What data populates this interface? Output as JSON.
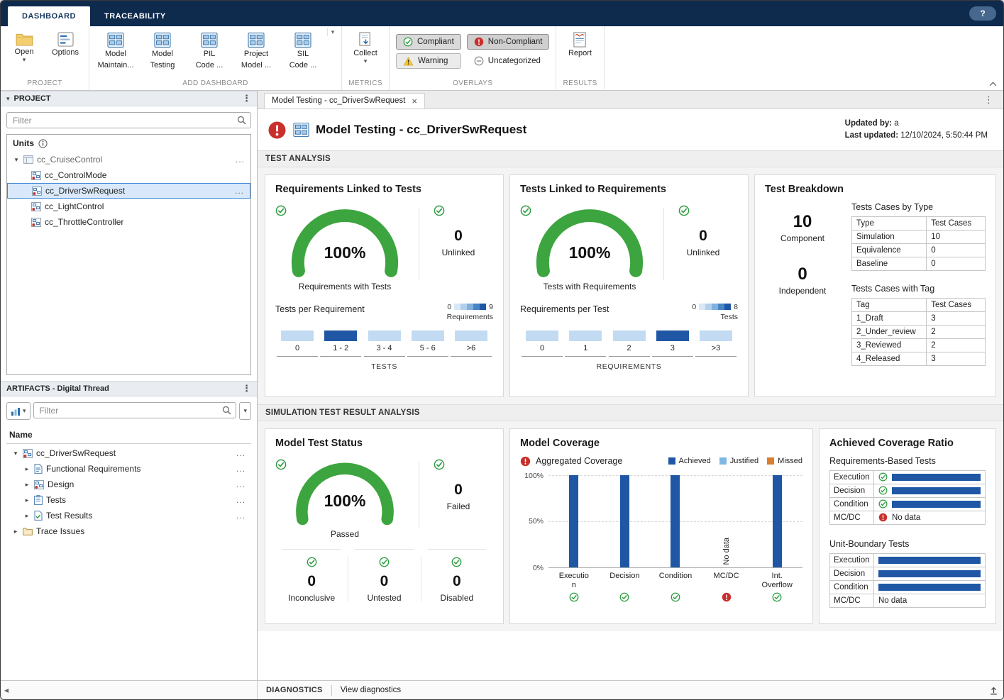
{
  "colors": {
    "navy": "#0e2a4d",
    "green": "#2f9e44",
    "gauge_green": "#3da53f",
    "red": "#c9302c",
    "bar_dark": "#1f57a5",
    "bar_light": "#c2dbf2",
    "justified_blue": "#7fb9e3",
    "missed_orange": "#d97f2e",
    "warning_yellow": "#f3c73f",
    "selection_blue": "#3c87d4"
  },
  "icons": {
    "caret_down": "▾",
    "caret_right": "▸",
    "kebab": "⋮",
    "scroll_left": "◀",
    "close": "×"
  },
  "titlebar": {
    "tabs": [
      {
        "label": "DASHBOARD"
      },
      {
        "label": "TRACEABILITY"
      }
    ],
    "help_label": "?"
  },
  "ribbon": {
    "group_project": "PROJECT",
    "open_label": "Open",
    "options_label": "Options",
    "group_add": "ADD DASHBOARD",
    "dashboards": [
      {
        "line1": "Model",
        "line2": "Maintain..."
      },
      {
        "line1": "Model",
        "line2": "Testing"
      },
      {
        "line1": "PIL",
        "line2": "Code ..."
      },
      {
        "line1": "Project",
        "line2": "Model ..."
      },
      {
        "line1": "SIL",
        "line2": "Code ..."
      }
    ],
    "group_metrics": "METRICS",
    "collect_label": "Collect",
    "group_overlays": "OVERLAYS",
    "overlays": [
      {
        "label": "Compliant"
      },
      {
        "label": "Non-Compliant"
      },
      {
        "label": "Warning"
      },
      {
        "label": "Uncategorized"
      }
    ],
    "group_results": "RESULTS",
    "report_label": "Report"
  },
  "sidebar": {
    "project": {
      "title": "PROJECT",
      "filter_placeholder": "Filter",
      "units_label": "Units",
      "row_menu": "...",
      "tree": [
        {
          "label": "cc_CruiseControl"
        },
        {
          "label": "cc_ControlMode"
        },
        {
          "label": "cc_DriverSwRequest"
        },
        {
          "label": "cc_LightControl"
        },
        {
          "label": "cc_ThrottleController"
        }
      ]
    },
    "artifacts": {
      "title": "ARTIFACTS - Digital Thread",
      "filter_placeholder": "Filter",
      "name_header": "Name",
      "row_menu": "...",
      "tree": [
        {
          "label": "cc_DriverSwRequest"
        },
        {
          "label": "Functional Requirements"
        },
        {
          "label": "Design"
        },
        {
          "label": "Tests"
        },
        {
          "label": "Test Results"
        },
        {
          "label": "Trace Issues"
        }
      ]
    }
  },
  "document": {
    "tab_label": "Model Testing - cc_DriverSwRequest",
    "title": "Model Testing - cc_DriverSwRequest",
    "updated_by_label": "Updated by:",
    "updated_by_value": "a",
    "last_updated_label": "Last updated:",
    "last_updated_value": "12/10/2024, 5:50:44 PM"
  },
  "test_analysis": {
    "section_title": "TEST ANALYSIS",
    "req_linked": {
      "title": "Requirements Linked to Tests",
      "gauge_value": "100%",
      "gauge_label": "Requirements with Tests",
      "unlinked_value": "0",
      "unlinked_label": "Unlinked",
      "hist": {
        "title": "Tests per Requirement",
        "axis_label": "TESTS",
        "scale_min": "0",
        "scale_max": "9",
        "scale_label": "Requirements",
        "bins": [
          {
            "label": "0",
            "count": 0
          },
          {
            "label": "1 - 2",
            "count": 9
          },
          {
            "label": "3 - 4",
            "count": 0
          },
          {
            "label": "5 - 6",
            "count": 0
          },
          {
            "label": ">6",
            "count": 0
          }
        ]
      }
    },
    "tests_linked": {
      "title": "Tests Linked to Requirements",
      "gauge_value": "100%",
      "gauge_label": "Tests with Requirements",
      "unlinked_value": "0",
      "unlinked_label": "Unlinked",
      "hist": {
        "title": "Requirements per Test",
        "axis_label": "REQUIREMENTS",
        "scale_min": "0",
        "scale_max": "8",
        "scale_label": "Tests",
        "bins": [
          {
            "label": "0",
            "count": 0
          },
          {
            "label": "1",
            "count": 0
          },
          {
            "label": "2",
            "count": 0
          },
          {
            "label": "3",
            "count": 8
          },
          {
            "label": ">3",
            "count": 0
          }
        ]
      }
    },
    "breakdown": {
      "title": "Test Breakdown",
      "component_value": "10",
      "component_label": "Component",
      "independent_value": "0",
      "independent_label": "Independent",
      "by_type": {
        "title": "Tests Cases by Type",
        "headers": [
          "Type",
          "Test Cases"
        ],
        "rows": [
          [
            "Simulation",
            "10"
          ],
          [
            "Equivalence",
            "0"
          ],
          [
            "Baseline",
            "0"
          ]
        ]
      },
      "with_tag": {
        "title": "Tests Cases with Tag",
        "headers": [
          "Tag",
          "Test Cases"
        ],
        "rows": [
          [
            "1_Draft",
            "3"
          ],
          [
            "2_Under_review",
            "2"
          ],
          [
            "3_Reviewed",
            "2"
          ],
          [
            "4_Released",
            "3"
          ]
        ]
      }
    }
  },
  "sim_analysis": {
    "section_title": "SIMULATION TEST RESULT ANALYSIS",
    "test_status": {
      "title": "Model Test Status",
      "gauge_value": "100%",
      "gauge_label": "Passed",
      "failed_value": "0",
      "failed_label": "Failed",
      "stats": [
        {
          "value": "0",
          "label": "Inconclusive"
        },
        {
          "value": "0",
          "label": "Untested"
        },
        {
          "value": "0",
          "label": "Disabled"
        }
      ]
    },
    "coverage": {
      "title": "Model Coverage",
      "aggregated_label": "Aggregated Coverage",
      "legend": [
        {
          "label": "Achieved"
        },
        {
          "label": "Justified"
        },
        {
          "label": "Missed"
        }
      ],
      "chart_data": {
        "type": "bar",
        "series_name": "Achieved",
        "categories": [
          "Execution",
          "Decision",
          "Condition",
          "MC/DC",
          "Int. Overflow"
        ],
        "tick_labels": [
          "Executio\nn",
          "Decision",
          "Condition",
          "MC/DC",
          "Int.\nOverflow"
        ],
        "values": [
          100,
          100,
          100,
          null,
          100
        ],
        "statuses": [
          "pass",
          "pass",
          "pass",
          "fail",
          "pass"
        ],
        "no_data_label": "No data",
        "y_ticks": [
          "100%",
          "50%",
          "0%"
        ],
        "ylim": [
          0,
          100
        ]
      }
    },
    "ratio": {
      "title": "Achieved Coverage Ratio",
      "req_based": {
        "title": "Requirements-Based Tests",
        "rows": [
          {
            "label": "Execution",
            "status": "pass",
            "bar": 100
          },
          {
            "label": "Decision",
            "status": "pass",
            "bar": 100
          },
          {
            "label": "Condition",
            "status": "pass",
            "bar": 100
          },
          {
            "label": "MC/DC",
            "status": "fail",
            "value_text": "No data"
          }
        ]
      },
      "unit_boundary": {
        "title": "Unit-Boundary Tests",
        "rows": [
          {
            "label": "Execution",
            "bar": 100
          },
          {
            "label": "Decision",
            "bar": 100
          },
          {
            "label": "Condition",
            "bar": 100
          },
          {
            "label": "MC/DC",
            "value_text": "No data"
          }
        ]
      }
    }
  },
  "statusbar": {
    "diagnostics_label": "DIAGNOSTICS",
    "view_link": "View diagnostics"
  }
}
